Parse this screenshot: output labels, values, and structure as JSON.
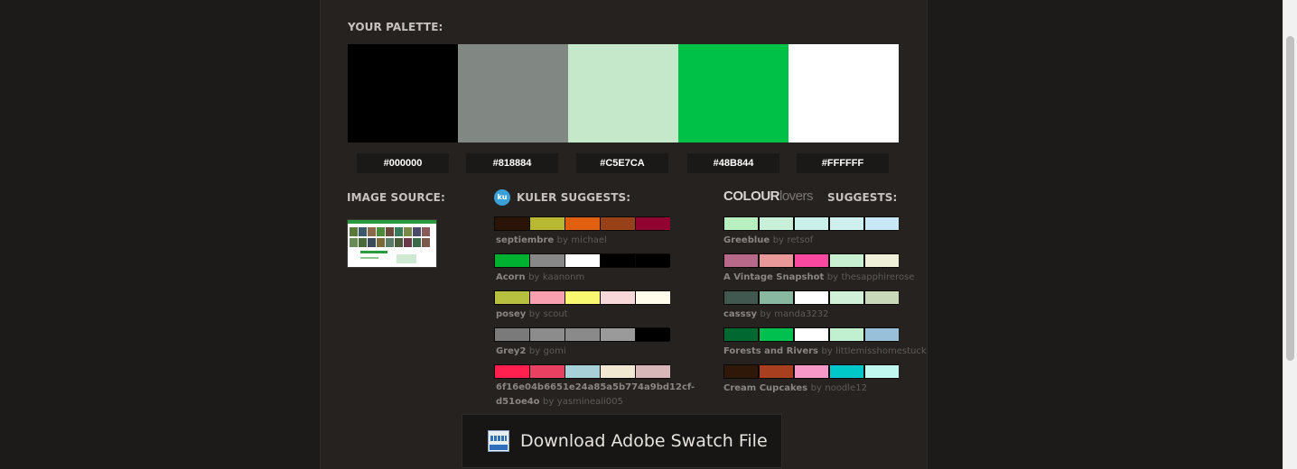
{
  "palette": {
    "heading": "YOUR PALETTE:",
    "colors": [
      {
        "hex": "#000000",
        "color": "#000000"
      },
      {
        "hex": "#818884",
        "color": "#818884"
      },
      {
        "hex": "#C5E7CA",
        "color": "#C5E7CA"
      },
      {
        "hex": "#48B844",
        "color": "#00C148"
      },
      {
        "hex": "#FFFFFF",
        "color": "#FFFFFF"
      }
    ]
  },
  "image_source": {
    "heading": "IMAGE SOURCE:"
  },
  "kuler": {
    "icon_text": "ku",
    "heading": "KULER SUGGESTS:",
    "items": [
      {
        "name": "septiembre",
        "by": "by",
        "author": "michael",
        "colors": [
          "#2a1408",
          "#b8b832",
          "#e06010",
          "#984018",
          "#900030"
        ]
      },
      {
        "name": "Acorn",
        "by": "by",
        "author": "kaanonm",
        "colors": [
          "#00b030",
          "#888888",
          "#ffffff",
          "#000000",
          "#000000"
        ]
      },
      {
        "name": "posey",
        "by": "by",
        "author": "scout",
        "colors": [
          "#b8c040",
          "#f8a0b0",
          "#f8f870",
          "#f8d8d8",
          "#fffcec"
        ]
      },
      {
        "name": "Grey2",
        "by": "by",
        "author": "gomi",
        "colors": [
          "#7a7a7a",
          "#8c8c8c",
          "#8a8a8a",
          "#9a9a9a",
          "#000000"
        ]
      },
      {
        "name": "6f16e04b6651e24a85a5b774a9bd12cf-d51oe4o",
        "by": "by",
        "author": "yasmineali005",
        "colors": [
          "#ff2050",
          "#e84060",
          "#a8d0d8",
          "#f0e8d0",
          "#d8b8b8"
        ]
      }
    ]
  },
  "colourlovers": {
    "logo_main": "COLOUR",
    "logo_sub": "lovers",
    "heading": "SUGGESTS:",
    "items": [
      {
        "name": "Greeblue",
        "by": "by",
        "author": "retsof",
        "colors": [
          "#b8f0c0",
          "#c8f0d8",
          "#c8f0e8",
          "#d0f0f0",
          "#c8e8f8"
        ]
      },
      {
        "name": "A Vintage Snapshot",
        "by": "by",
        "author": "thesapphirerose",
        "colors": [
          "#b86888",
          "#e89898",
          "#f848a0",
          "#c8f0d0",
          "#f0f0d8"
        ]
      },
      {
        "name": "casssy",
        "by": "by",
        "author": "manda3232",
        "colors": [
          "#405850",
          "#88b8a0",
          "#ffffff",
          "#d0f0d8",
          "#c8d8b8"
        ]
      },
      {
        "name": "Forests and Rivers",
        "by": "by",
        "author": "littlemisshomestuck",
        "colors": [
          "#006830",
          "#00c050",
          "#ffffff",
          "#c0f0d0",
          "#98c0d8"
        ]
      },
      {
        "name": "Cream Cupcakes",
        "by": "by",
        "author": "noodle12",
        "colors": [
          "#301808",
          "#a84020",
          "#f898c8",
          "#00c8c8",
          "#c0f8f0"
        ]
      }
    ]
  },
  "download": {
    "label": "Download Adobe Swatch File",
    "icon": "swatch-file-icon"
  }
}
